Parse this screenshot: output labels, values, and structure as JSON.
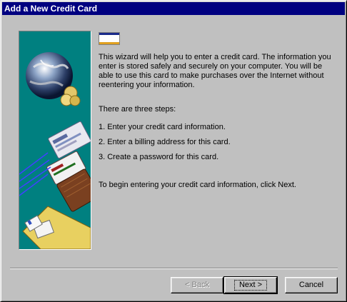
{
  "window": {
    "title": "Add a New Credit Card"
  },
  "logo": {
    "text": "VISA",
    "icon": "visa-card-icon"
  },
  "art": {
    "icon": "wizard-illustration-globe-cards"
  },
  "content": {
    "intro": "This wizard will help you to enter a credit card. The information you enter is stored safely and securely on your computer. You will be able to use this card to make purchases over the Internet without reentering your information.",
    "steps_heading": "There are three steps:",
    "steps": [
      "1. Enter your credit card information.",
      "2. Enter a billing address for this card.",
      "3. Create a password for this card."
    ],
    "closing": "To begin entering your credit card information, click Next."
  },
  "buttons": {
    "back": "< Back",
    "next": "Next >",
    "cancel": "Cancel"
  },
  "colors": {
    "title_bar": "#000080",
    "panel": "#008080",
    "face": "#c0c0c0"
  }
}
